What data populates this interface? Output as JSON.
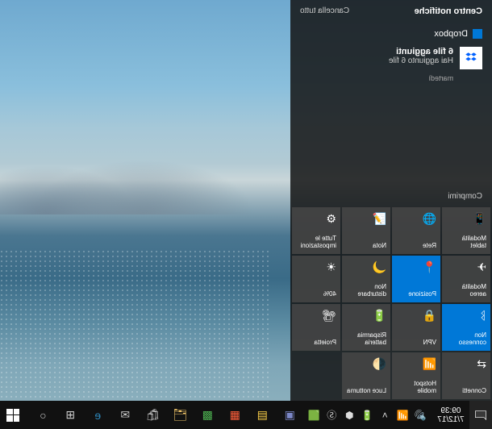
{
  "actionCenter": {
    "title": "Centro notifiche",
    "clearAll": "Cancella tutto",
    "collapse": "Comprimi",
    "group": {
      "appName": "Dropbox",
      "notifTitle": "6 file aggiunti",
      "notifBody": "Hai aggiunto 6 file",
      "notifTime": "martedì"
    },
    "tiles": [
      {
        "icon": "📱",
        "label": "Modalità tablet",
        "active": false
      },
      {
        "icon": "🌐",
        "label": "Rete",
        "active": false
      },
      {
        "icon": "📝",
        "label": "Nota",
        "active": false
      },
      {
        "icon": "⚙",
        "label": "Tutte le impostazioni",
        "active": false
      },
      {
        "icon": "✈",
        "label": "Modalità aereo",
        "active": false
      },
      {
        "icon": "📍",
        "label": "Posizione",
        "active": true
      },
      {
        "icon": "🌙",
        "label": "Non disturbare",
        "active": false
      },
      {
        "icon": "☀",
        "label": "40%",
        "active": false
      },
      {
        "icon": "ᛒ",
        "label": "Non connesso",
        "active": true
      },
      {
        "icon": "🔒",
        "label": "VPN",
        "active": false
      },
      {
        "icon": "🔋",
        "label": "Risparmia batteria",
        "active": false
      },
      {
        "icon": "📽",
        "label": "Proietta",
        "active": false
      },
      {
        "icon": "⇄",
        "label": "Connetti",
        "active": false
      },
      {
        "icon": "📶",
        "label": "Hotspot mobile",
        "active": false
      },
      {
        "icon": "🌓",
        "label": "Luce notturna",
        "active": false
      }
    ]
  },
  "taskbar": {
    "clock": {
      "time": "09:39",
      "date": "7/12/17"
    }
  }
}
